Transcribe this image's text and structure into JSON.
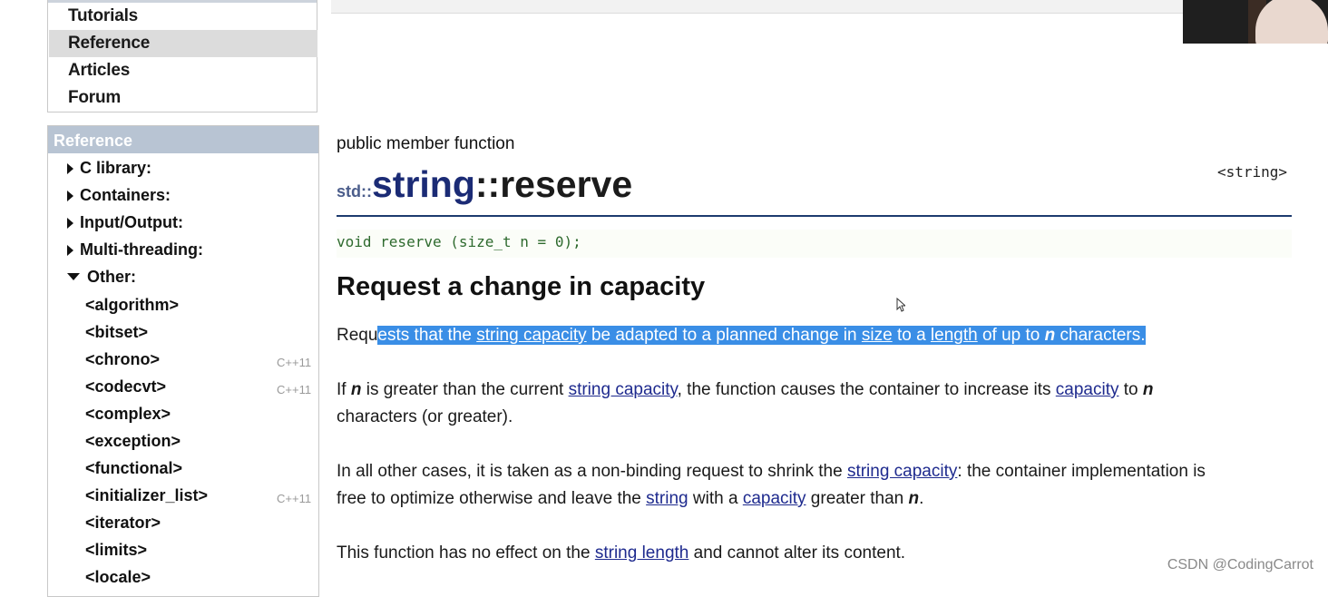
{
  "top_nav": {
    "items": [
      {
        "label": "Tutorials",
        "active": false
      },
      {
        "label": "Reference",
        "active": true
      },
      {
        "label": "Articles",
        "active": false
      },
      {
        "label": "Forum",
        "active": false
      }
    ]
  },
  "sidebar": {
    "heading": "Reference",
    "groups": [
      {
        "label": "C library:",
        "expanded": false
      },
      {
        "label": "Containers:",
        "expanded": false
      },
      {
        "label": "Input/Output:",
        "expanded": false
      },
      {
        "label": "Multi-threading:",
        "expanded": false
      },
      {
        "label": "Other:",
        "expanded": true
      }
    ],
    "headers": [
      {
        "label": "<algorithm>",
        "badge": ""
      },
      {
        "label": "<bitset>",
        "badge": ""
      },
      {
        "label": "<chrono>",
        "badge": "C++11"
      },
      {
        "label": "<codecvt>",
        "badge": "C++11"
      },
      {
        "label": "<complex>",
        "badge": ""
      },
      {
        "label": "<exception>",
        "badge": ""
      },
      {
        "label": "<functional>",
        "badge": ""
      },
      {
        "label": "<initializer_list>",
        "badge": "C++11"
      },
      {
        "label": "<iterator>",
        "badge": ""
      },
      {
        "label": "<limits>",
        "badge": ""
      },
      {
        "label": "<locale>",
        "badge": ""
      }
    ]
  },
  "main": {
    "kind": "public member function",
    "header_file": "<string>",
    "title": {
      "ns": "std::",
      "cls": "string",
      "fn": "::reserve"
    },
    "prototype": "void reserve (size_t n = 0);",
    "heading": "Request a change in capacity",
    "p1": {
      "a": "Requ",
      "b": "ests that the ",
      "link1": "string capacity",
      "c": " be adapted to a planned change in ",
      "link2": "size",
      "d": " to a ",
      "link3": "length",
      "e": " of up to ",
      "n": "n",
      "f": " characters."
    },
    "p2": {
      "a": "If ",
      "n1": "n",
      "b": " is greater than the current ",
      "link1": "string capacity",
      "c": ", the function causes the container to increase its ",
      "link2": "capacity",
      "d": " to ",
      "n2": "n",
      "e": "characters (or greater)."
    },
    "p3": {
      "a": "In all other cases, it is taken as a non-binding request to shrink the ",
      "link1": "string capacity",
      "b": ": the container implementation is",
      "c": "free to optimize otherwise and leave the ",
      "link2": "string",
      "d": " with a ",
      "link3": "capacity",
      "e": " greater than ",
      "n": "n",
      "f": "."
    },
    "p4": {
      "a": "This function has no effect on the ",
      "link1": "string length",
      "b": " and cannot alter its content."
    }
  },
  "watermark": "CSDN @CodingCarrot"
}
